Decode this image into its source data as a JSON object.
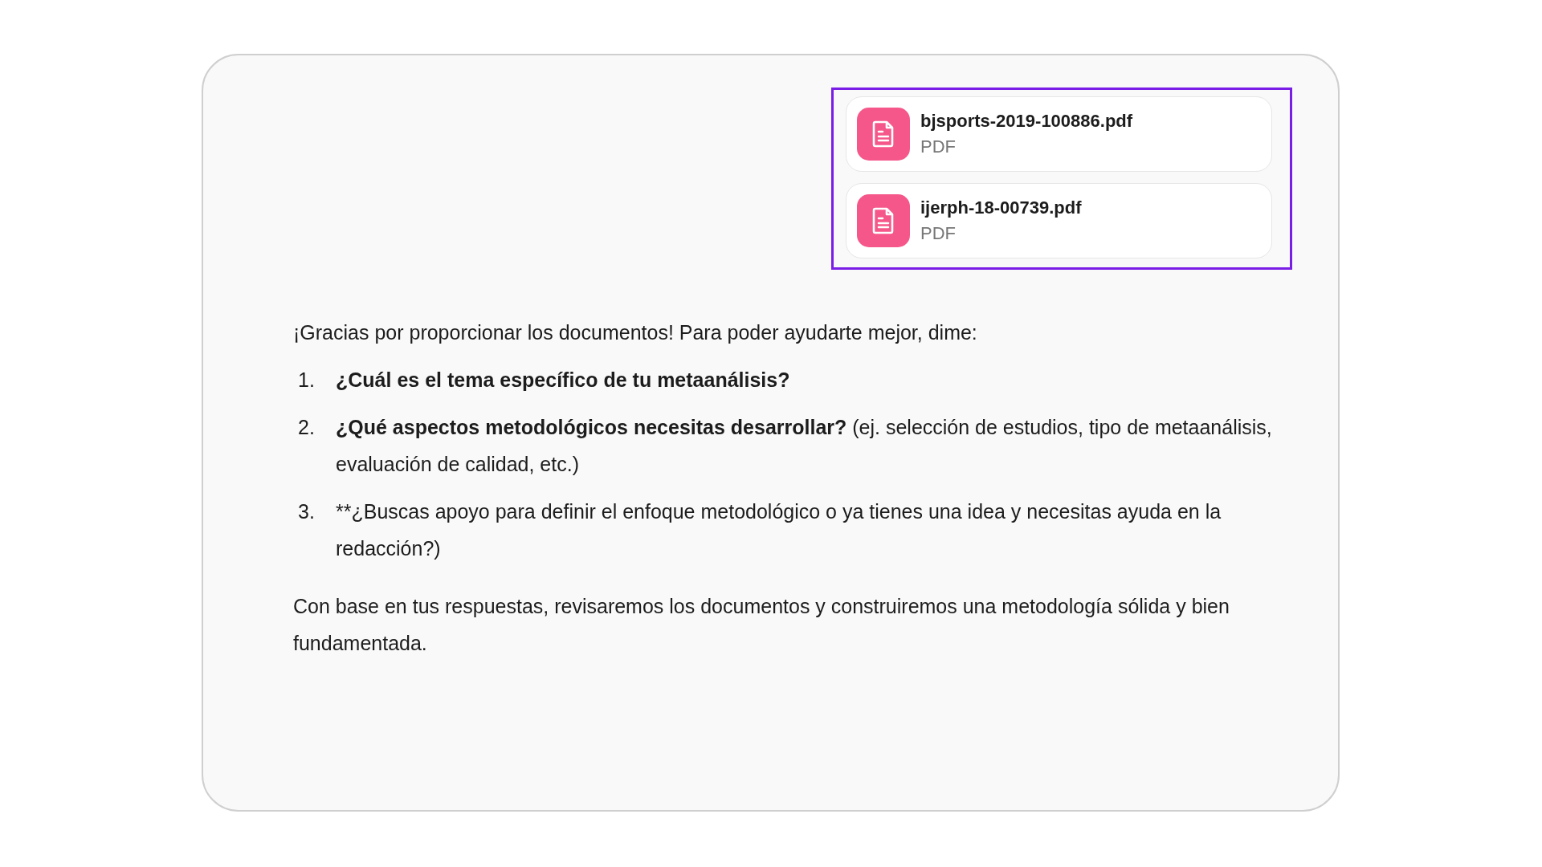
{
  "attachments": [
    {
      "name": "bjsports-2019-100886.pdf",
      "type": "PDF",
      "selected": true
    },
    {
      "name": "ijerph-18-00739.pdf",
      "type": "PDF",
      "selected": true
    }
  ],
  "message": {
    "intro": "¡Gracias por proporcionar los documentos! Para poder ayudarte mejor, dime:",
    "items": [
      {
        "number": "1.",
        "text": "**¿Cuál es el tema específico de tu metaanálisis?**"
      },
      {
        "number": "2.",
        "text": "**¿Qué aspectos metodológicos necesitas desarrollar?** (ej. selección de estudios, tipo de metaanálisis, evaluación de calidad, etc.)"
      },
      {
        "number": "3.",
        "text": "**¿Buscas apoyo para definir el enfoque metodológico o ya tienes una idea y necesitas ayuda en la redacción?)"
      }
    ],
    "closing": "Con base en tus respuestas, revisaremos los documentos y construiremos una metodología sólida y bien fundamentada."
  }
}
